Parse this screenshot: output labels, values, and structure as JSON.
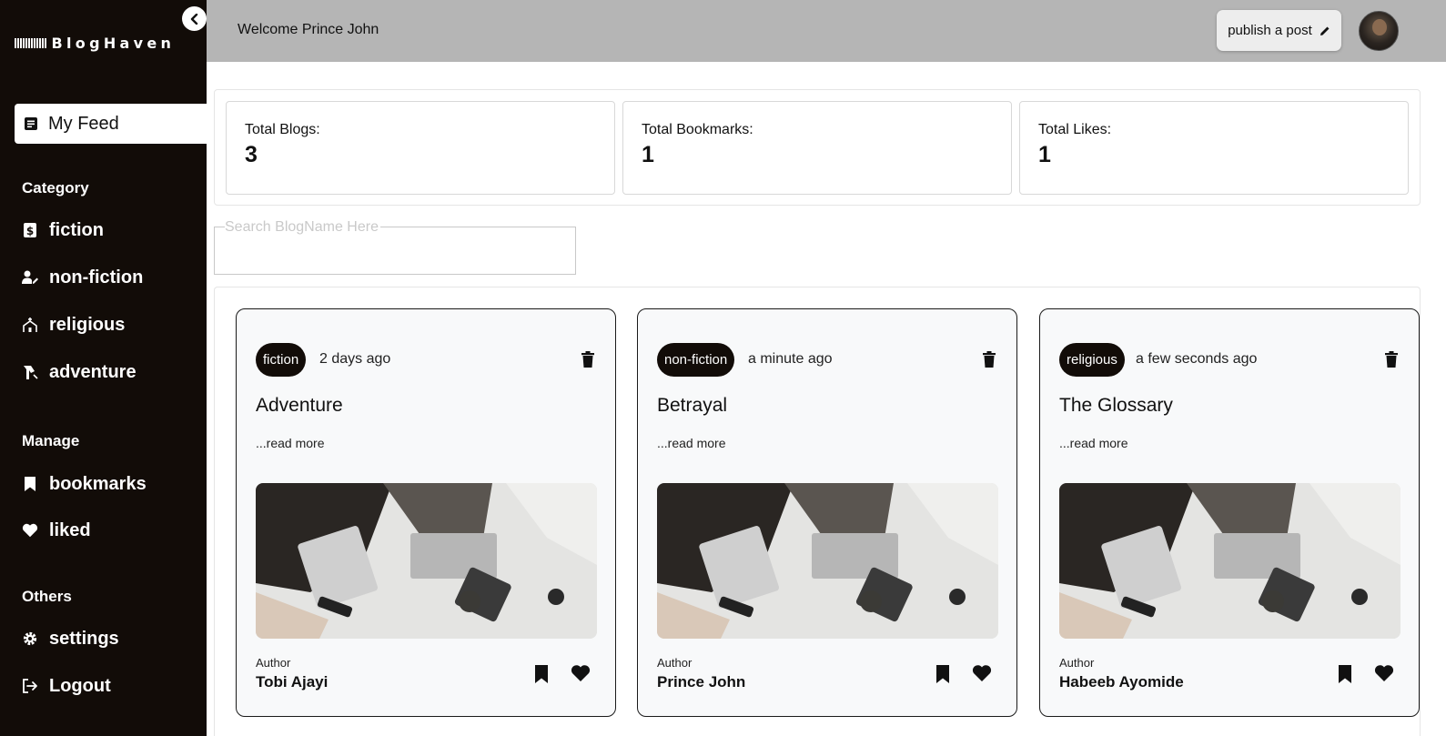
{
  "brand": {
    "name": "BlogHaven"
  },
  "sidebar": {
    "feed_label": "My Feed",
    "category_title": "Category",
    "categories": [
      {
        "label": "fiction",
        "icon": "fiction-book-icon"
      },
      {
        "label": "non-fiction",
        "icon": "user-edit-icon"
      },
      {
        "label": "religious",
        "icon": "church-icon"
      },
      {
        "label": "adventure",
        "icon": "adventure-icon"
      }
    ],
    "manage_title": "Manage",
    "manage": [
      {
        "label": "bookmarks",
        "icon": "bookmark-icon"
      },
      {
        "label": "liked",
        "icon": "heart-icon"
      }
    ],
    "others_title": "Others",
    "others": [
      {
        "label": "settings",
        "icon": "gear-icon"
      },
      {
        "label": "Logout",
        "icon": "logout-icon"
      }
    ]
  },
  "header": {
    "welcome": "Welcome Prince John",
    "publish_label": "publish a post"
  },
  "stats": [
    {
      "label": "Total Blogs:",
      "value": "3"
    },
    {
      "label": "Total Bookmarks:",
      "value": "1"
    },
    {
      "label": "Total Likes:",
      "value": "1"
    }
  ],
  "search": {
    "placeholder": "Search BlogName Here",
    "value": ""
  },
  "posts": [
    {
      "category": "fiction",
      "time": "2 days ago",
      "title": "Adventure",
      "read_more": "...read more",
      "author_label": "Author",
      "author": "Tobi Ajayi"
    },
    {
      "category": "non-fiction",
      "time": "a minute ago",
      "title": "Betrayal",
      "read_more": "...read more",
      "author_label": "Author",
      "author": "Prince John"
    },
    {
      "category": "religious",
      "time": "a few seconds ago",
      "title": "The Glossary",
      "read_more": "...read more",
      "author_label": "Author",
      "author": "Habeeb Ayomide"
    }
  ],
  "colors": {
    "sidebar": "#120c08",
    "header": "#b5b5b5",
    "accent": "#120c08"
  }
}
